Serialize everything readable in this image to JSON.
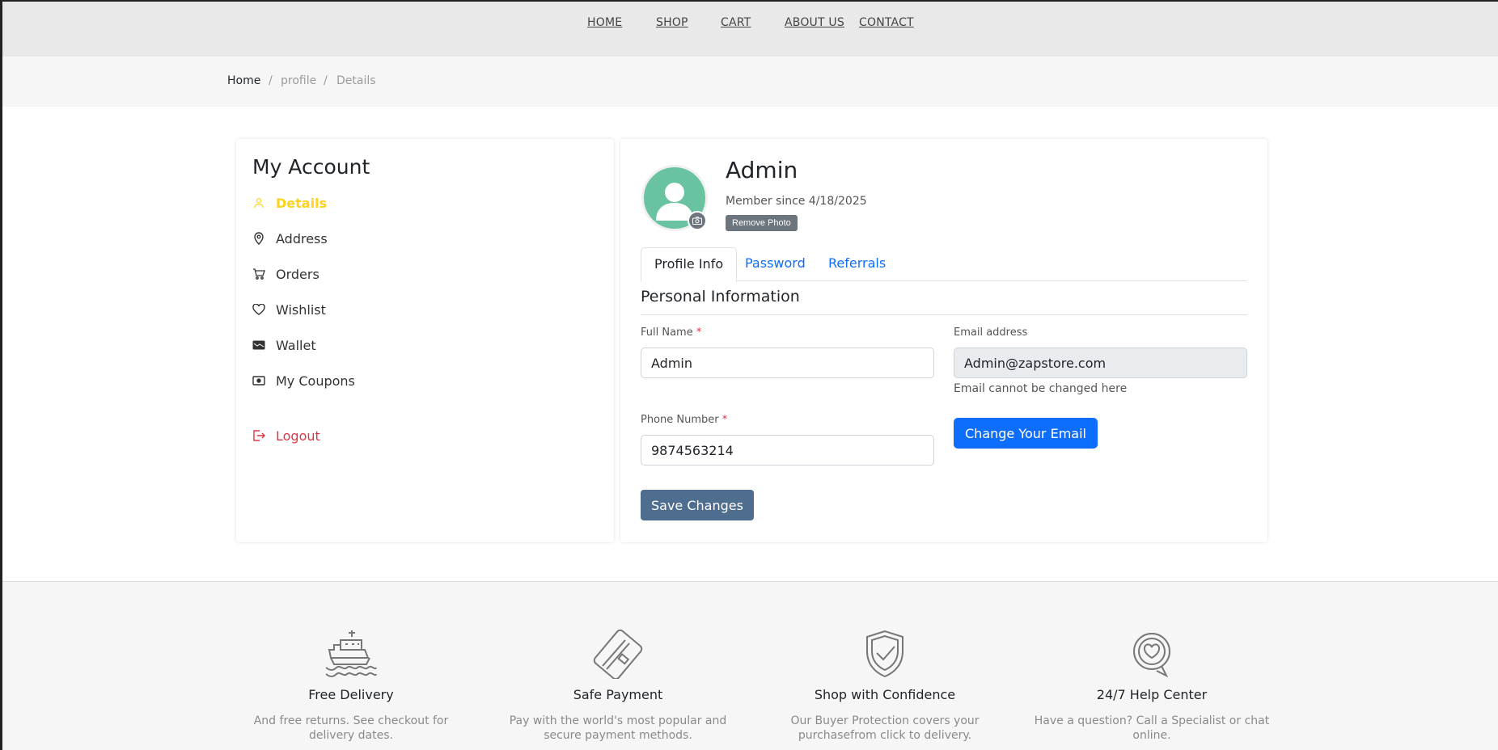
{
  "nav": {
    "home": "HOME",
    "shop": "SHOP",
    "cart": "CART",
    "about": "ABOUT US",
    "contact": "CONTACT"
  },
  "breadcrumb": {
    "home": "Home",
    "sep1": "/",
    "profile": "profile",
    "sep2": "/",
    "current": "Details"
  },
  "sidebar": {
    "title": "My Account",
    "items": [
      {
        "label": "Details",
        "icon": "user-icon"
      },
      {
        "label": "Address",
        "icon": "location-pin-icon"
      },
      {
        "label": "Orders",
        "icon": "cart-icon"
      },
      {
        "label": "Wishlist",
        "icon": "heart-icon"
      },
      {
        "label": "Wallet",
        "icon": "wallet-icon"
      },
      {
        "label": "My Coupons",
        "icon": "coupon-icon"
      }
    ],
    "logout": "Logout",
    "active_color": "#ffd21a",
    "logout_color": "#dc3545"
  },
  "profile": {
    "name": "Admin",
    "member_since": "Member since 4/18/2025",
    "remove_photo": "Remove Photo",
    "avatar_color": "#6ac3a0"
  },
  "tabs": {
    "profile_info": "Profile Info",
    "password": "Password",
    "referrals": "Referrals"
  },
  "form": {
    "section_title": "Personal Information",
    "full_name_label": "Full Name",
    "required_mark": "*",
    "full_name_value": "Admin",
    "email_label": "Email address",
    "email_value": "Admin@zapstore.com",
    "email_hint": "Email cannot be changed here",
    "phone_label": "Phone Number",
    "phone_value": "9874563214",
    "change_email": "Change Your Email",
    "save": "Save Changes"
  },
  "features": [
    {
      "title": "Free Delivery",
      "text": "And free returns. See checkout for delivery dates.",
      "icon": "ship-icon"
    },
    {
      "title": "Safe Payment",
      "text": "Pay with the world's most popular and secure payment methods.",
      "icon": "credit-card-icon"
    },
    {
      "title": "Shop with Confidence",
      "text": "Our Buyer Protection covers your purchasefrom click to delivery.",
      "icon": "shield-check-icon"
    },
    {
      "title": "24/7 Help Center",
      "text": "Have a question? Call a Specialist or chat online.",
      "icon": "chat-heart-icon"
    }
  ]
}
